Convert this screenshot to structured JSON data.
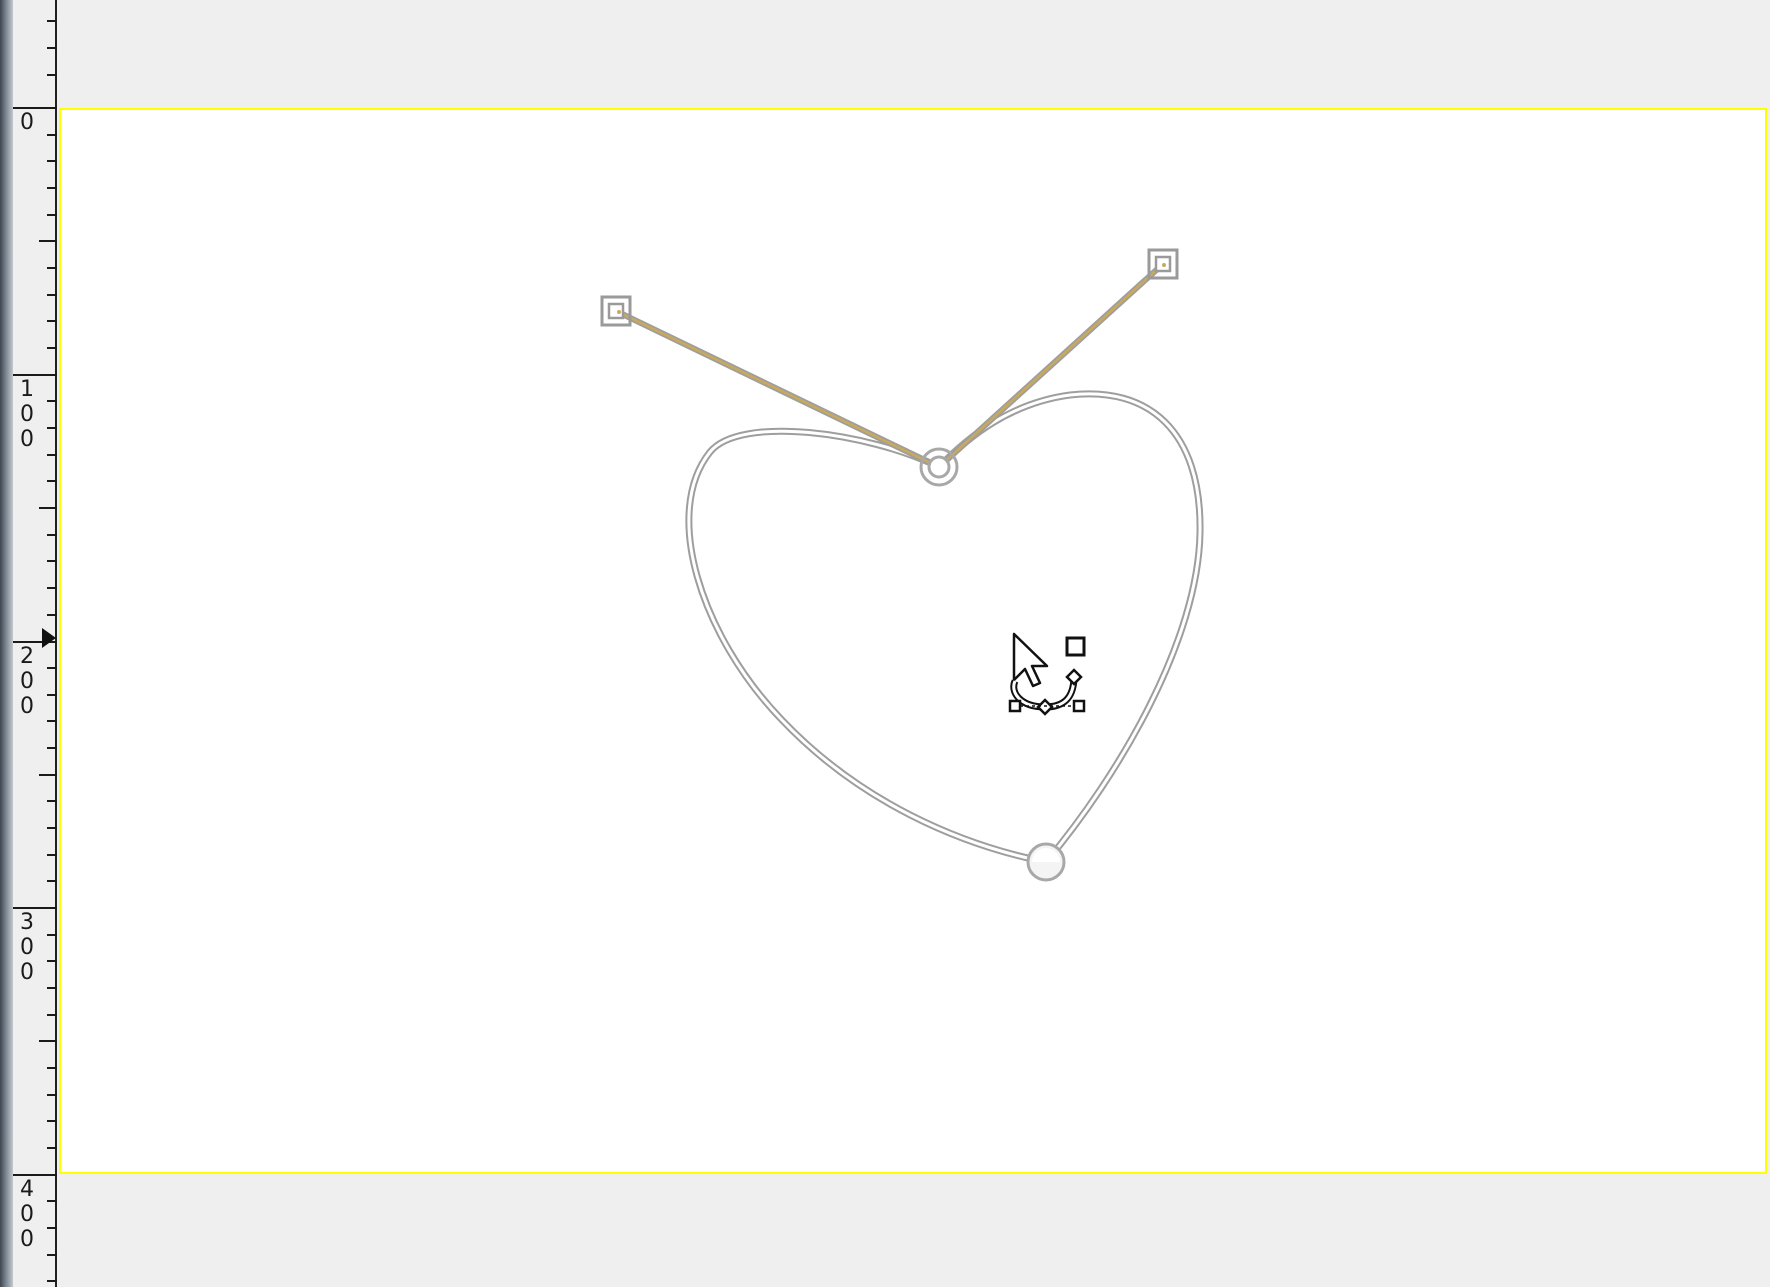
{
  "app": {
    "name": "GIMP",
    "active_tool": "Paths tool",
    "view": "image canvas"
  },
  "ruler": {
    "vertical_labels": [
      "0",
      "100",
      "200",
      "300",
      "400"
    ]
  },
  "canvas": {
    "background_color": "#ffffff",
    "surround_color": "#efefef",
    "boundary_dash_color": "#111111",
    "boundary_highlight_color": "#ffff00"
  },
  "path": {
    "shape": "heart",
    "stroke_color": "#b9b9b9",
    "handle_line_color": "#c9a95a",
    "anchors": [
      "top-center-anchor",
      "bottom-anchor"
    ],
    "handles": [
      "left-handle",
      "right-handle"
    ]
  },
  "icons": {
    "cursor": "pointer-arrow-icon",
    "tool_cursor": "paths-tool-cursor-icon"
  }
}
